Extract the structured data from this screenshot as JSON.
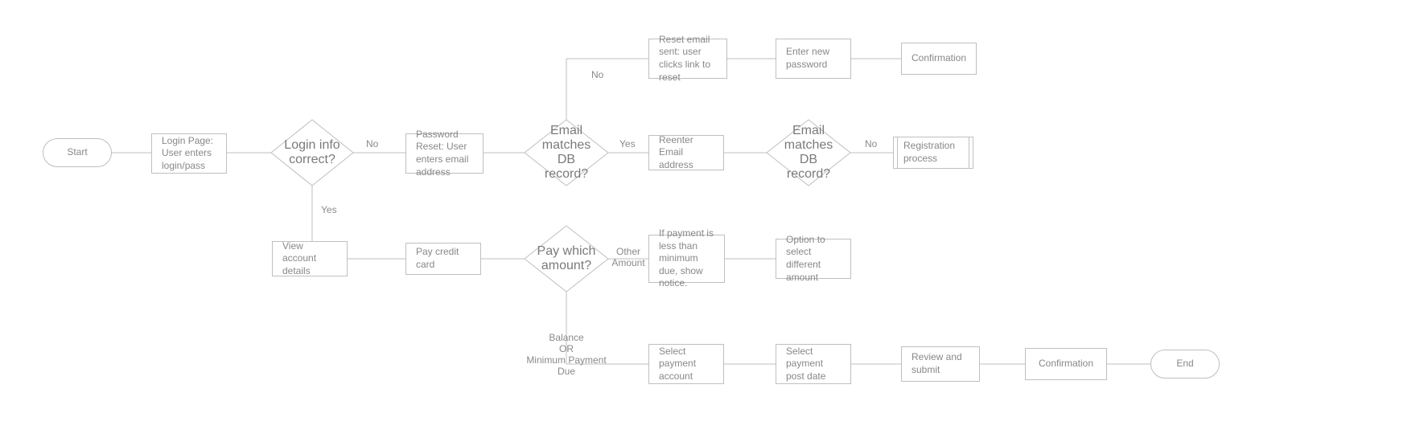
{
  "nodes": {
    "start": "Start",
    "login": "Login Page: User enters login/pass",
    "loginCorrect": "Login info correct?",
    "pwdReset": "Password Reset: User enters email address",
    "emailMatch1": "Email matches DB record?",
    "resetEmail": "Reset email sent: user clicks link to reset",
    "enterNewPwd": "Enter new password",
    "confirm1": "Confirmation",
    "reenterEmail": "Reenter Email address",
    "emailMatch2": "Email matches DB record?",
    "registration": "Registration process",
    "viewAccount": "View account details",
    "payCard": "Pay credit card",
    "payWhich": "Pay which amount?",
    "ifPayment": "If payment is less than minimum due, show notice.",
    "optionDiff": "Option to select different amount",
    "selectAccount": "Select payment account",
    "selectDate": "Select payment post date",
    "reviewSubmit": "Review and submit",
    "confirm2": "Confirmation",
    "end": "End"
  },
  "labels": {
    "no1": "No",
    "yes1": "Yes",
    "no2": "No",
    "yes2": "Yes",
    "no3": "No",
    "other": "Other\nAmount",
    "balance": "Balance\nOR\nMinimum Payment\nDue"
  }
}
